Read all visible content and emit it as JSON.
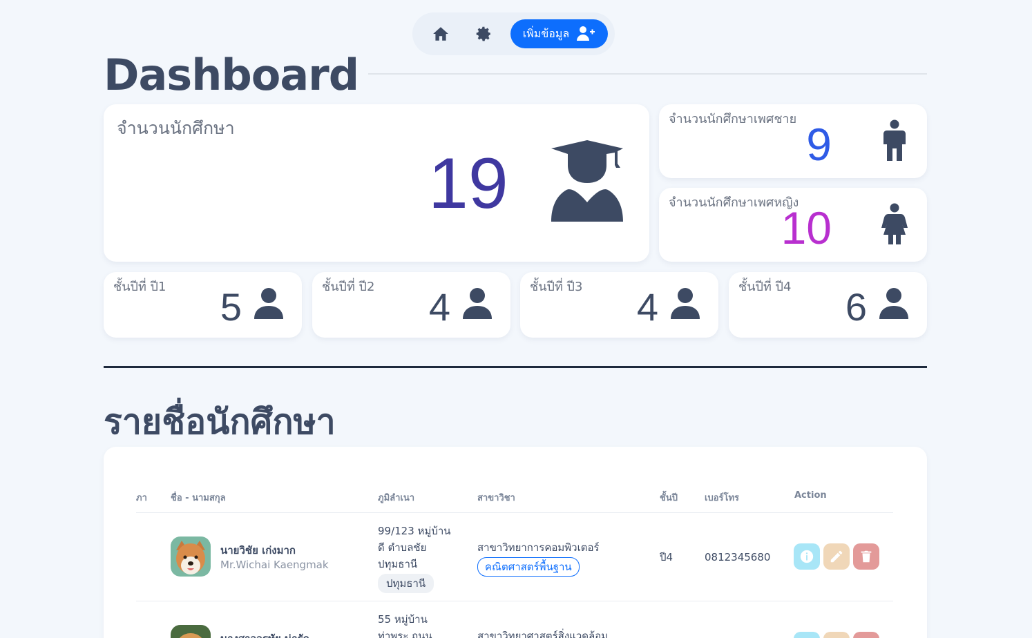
{
  "nav": {
    "home_icon": "home-icon",
    "settings_icon": "gear-icon",
    "add_label": "เพิ่มข้อมูล",
    "add_icon": "user-plus-icon"
  },
  "page_title": "Dashboard",
  "stats": {
    "total": {
      "label": "จำนวนนักศึกษา",
      "value": "19",
      "icon": "graduate-icon"
    },
    "male": {
      "label": "จำนวนนักศึกษาเพศชาย",
      "value": "9",
      "icon": "male-icon",
      "color": "#2f5be6"
    },
    "female": {
      "label": "จำนวนนักศึกษาเพศหญิง",
      "value": "10",
      "icon": "female-icon",
      "color": "#b82fcf"
    },
    "years": [
      {
        "label": "ชั้นปีที่ ปี1",
        "value": "5"
      },
      {
        "label": "ชั้นปีที่ ปี2",
        "value": "4"
      },
      {
        "label": "ชั้นปีที่ ปี3",
        "value": "4"
      },
      {
        "label": "ชั้นปีที่ ปี4",
        "value": "6"
      }
    ]
  },
  "students_section": {
    "title": "รายชื่อนักศึกษา",
    "columns": [
      "ภา",
      "ชื่อ - นามสกุล",
      "ภูมิลำเนา",
      "สาขาวิชา",
      "ชั้นปี",
      "เบอร์โทร",
      "Action"
    ],
    "rows": [
      {
        "name_th": "นายวิชัย  เก่งมาก",
        "name_en": "Mr.Wichai  Kaengmak",
        "address_lines": [
          "99/123 หมู่บ้าน",
          "ดี ตำบลชัย",
          "ปทุมธานี"
        ],
        "province": "ปทุมธานี",
        "major": "สาขาวิทยาการคอมพิวเตอร์",
        "faculty": "คณิตศาสตร์พื้นฐาน",
        "year": "ปี4",
        "phone": "0812345680"
      },
      {
        "name_th": "นางสาวอรทัย  น่ารัก",
        "address_lines": [
          "55 หมู่บ้าน",
          "ท่าพระ ถนน"
        ],
        "major": "สาขาวิทยาศาสตร์สิ่งแวดล้อม"
      }
    ]
  }
}
